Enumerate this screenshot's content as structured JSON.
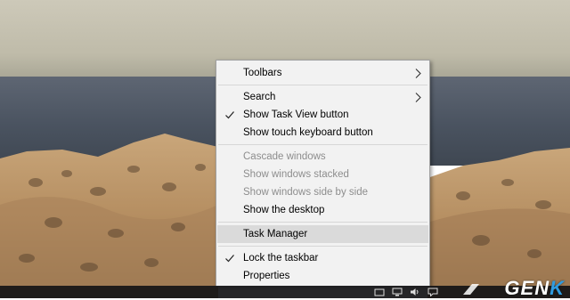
{
  "menu": {
    "items": [
      {
        "label": "Toolbars",
        "submenu": true
      },
      {
        "label": "Search",
        "submenu": true
      },
      {
        "label": "Show Task View button",
        "checked": true
      },
      {
        "label": "Show touch keyboard button"
      },
      {
        "label": "Cascade windows",
        "disabled": true
      },
      {
        "label": "Show windows stacked",
        "disabled": true
      },
      {
        "label": "Show windows side by side",
        "disabled": true
      },
      {
        "label": "Show the desktop"
      },
      {
        "label": "Task Manager",
        "highlighted": true
      },
      {
        "label": "Lock the taskbar",
        "checked": true
      },
      {
        "label": "Properties"
      }
    ]
  },
  "watermark": {
    "text_main": "GEN",
    "text_accent": "K"
  },
  "colors": {
    "menu_bg": "#f2f2f2",
    "highlight": "#dadada",
    "disabled_text": "#8d8d8d",
    "taskbar": "#141416",
    "watermark_accent": "#2f9be0"
  },
  "icons": [
    "check-icon",
    "chevron-right-icon",
    "network-icon",
    "volume-icon",
    "notification-icon"
  ]
}
